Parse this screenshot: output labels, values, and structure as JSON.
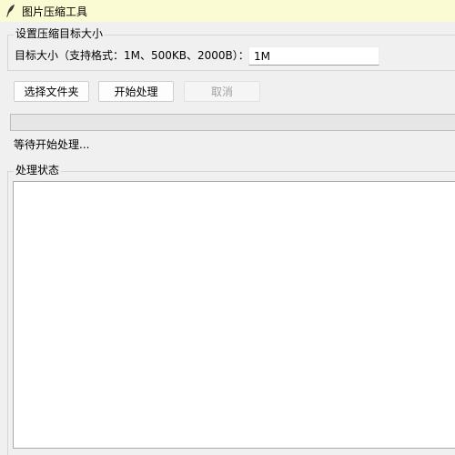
{
  "window": {
    "title": "图片压缩工具",
    "icon": "feather-icon"
  },
  "target_group": {
    "legend": "设置压缩目标大小",
    "label": "目标大小（支持格式：1M、500KB、2000B）：",
    "value": "1M"
  },
  "buttons": {
    "select_folder": "选择文件夹",
    "start": "开始处理",
    "cancel": "取消"
  },
  "progress": {
    "value": 0
  },
  "status_text": "等待开始处理...",
  "status_group": {
    "legend": "处理状态",
    "log": ""
  },
  "colors": {
    "titlebar": "#fbfbd3",
    "window_bg": "#f0f0f0",
    "disabled_text": "#a0a0a0"
  }
}
